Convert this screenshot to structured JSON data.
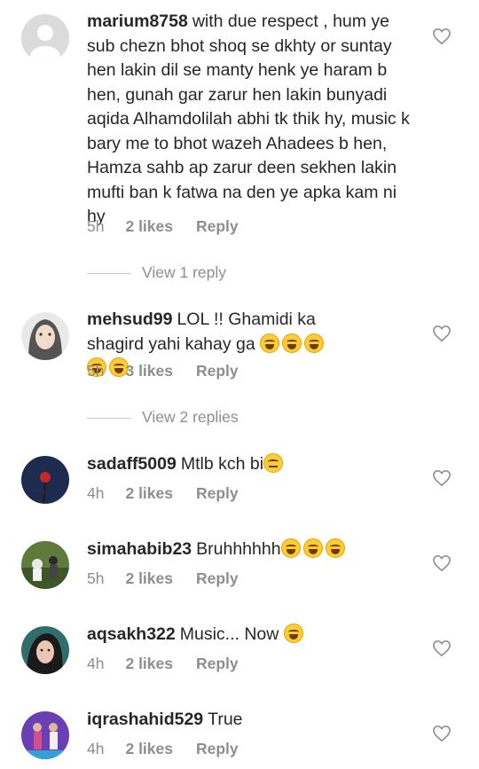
{
  "comments": [
    {
      "username": "marium8758",
      "text": "with due respect , hum ye sub chezn bhot shoq se dkhty or suntay hen lakin dil se manty henk ye haram b hen, gunah gar zarur hen lakin bunyadi aqida Alhamdolilah abhi tk thik hy, music k bary me to bhot wazeh Ahadees b hen, Hamza sahb ap zarur deen sekhen lakin mufti ban k fatwa na den ye apka kam ni hy",
      "time": "5h",
      "likes": "2 likes",
      "reply": "Reply",
      "view_replies": "View 1 reply"
    },
    {
      "username": "mehsud99",
      "text": "LOL !! Ghamidi ka shagird yahi kahay ga",
      "emoji": "😂😂😂😂😂",
      "time": "5h",
      "likes": "3 likes",
      "reply": "Reply",
      "view_replies": "View 2 replies"
    },
    {
      "username": "sadaff5009",
      "text": "Mtlb kch bi",
      "emoji": "😑",
      "time": "4h",
      "likes": "2 likes",
      "reply": "Reply"
    },
    {
      "username": "simahabib23",
      "text": "Bruhhhhhh",
      "emoji": "😂😂😂",
      "time": "5h",
      "likes": "2 likes",
      "reply": "Reply"
    },
    {
      "username": "aqsakh322",
      "text": "Music... Now",
      "emoji": "😂",
      "time": "4h",
      "likes": "2 likes",
      "reply": "Reply"
    },
    {
      "username": "iqrashahid529",
      "text": "True",
      "time": "4h",
      "likes": "2 likes",
      "reply": "Reply"
    }
  ],
  "icons": {
    "like": "heart-outline-icon",
    "avatar_placeholder": "default-avatar-icon"
  }
}
